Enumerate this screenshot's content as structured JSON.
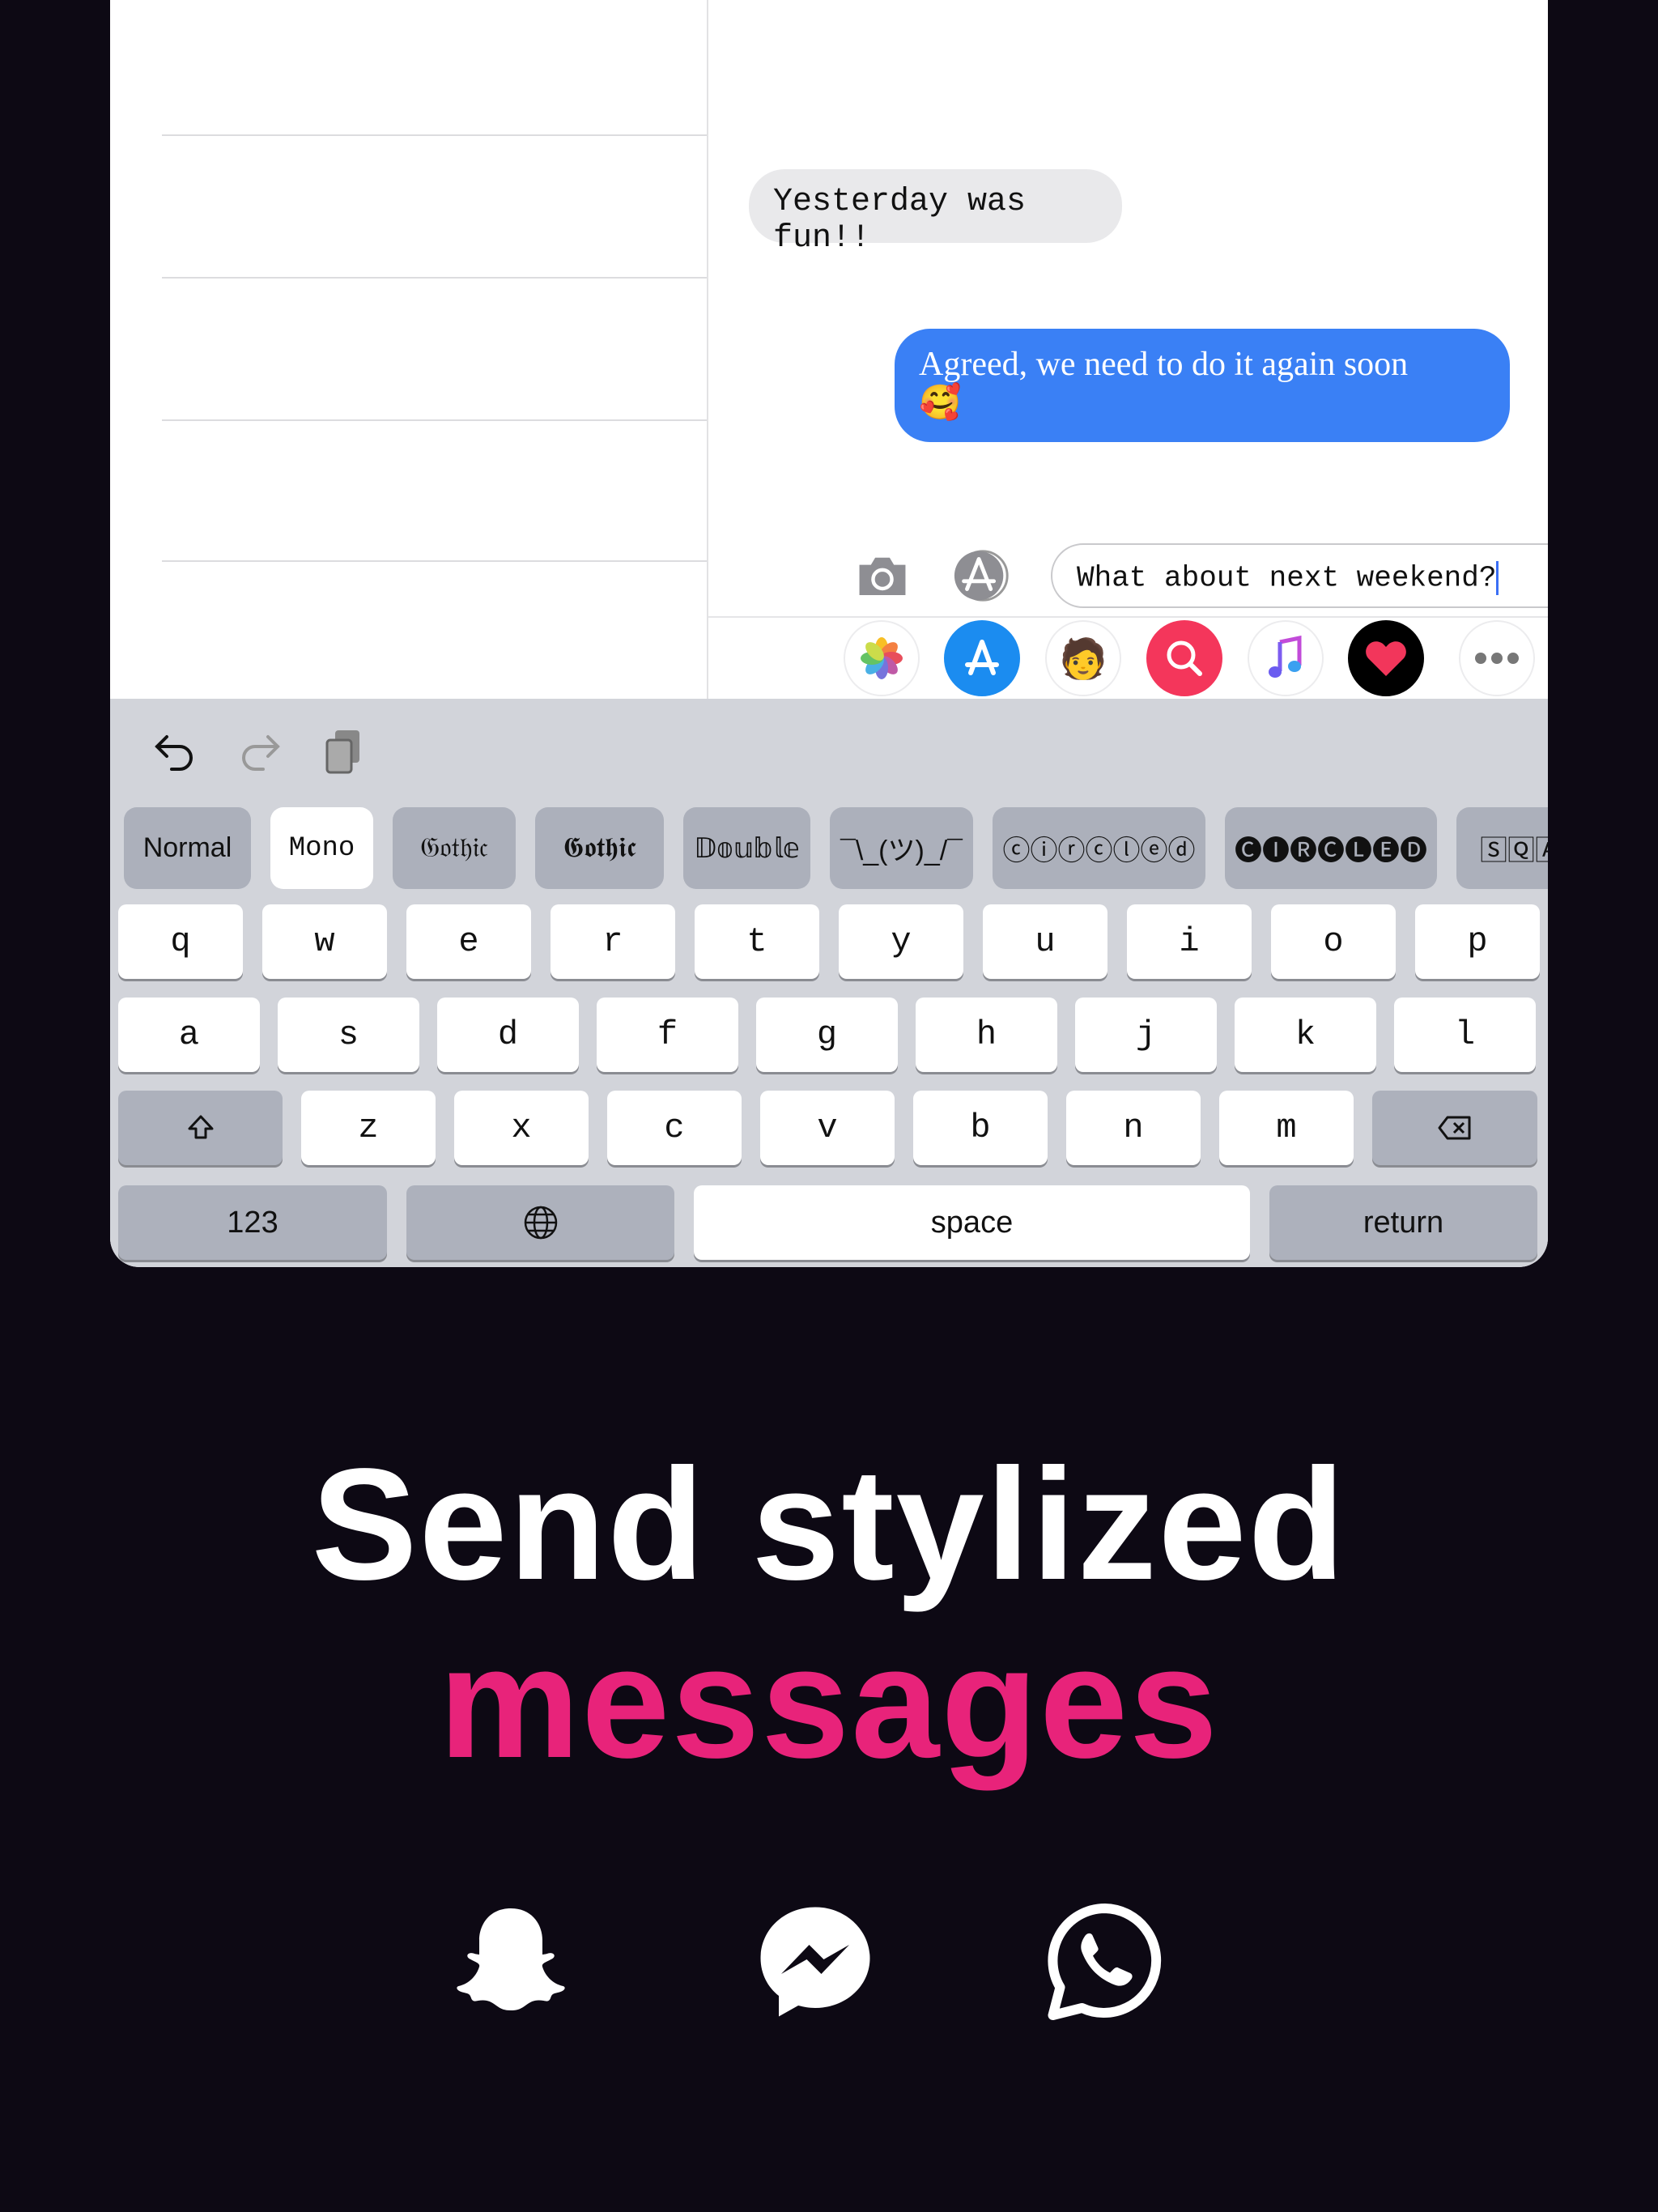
{
  "messages": [
    {
      "direction": "incoming",
      "text": "Yesterday was fun!!"
    },
    {
      "direction": "outgoing",
      "text": "Agreed, we need to do it again soon",
      "emoji": "🥰"
    }
  ],
  "composer": {
    "value": "What about next weekend?"
  },
  "app_drawer": [
    "photos-icon",
    "app-store-icon",
    "memoji-icon",
    "image-search-icon",
    "music-icon",
    "digital-touch-icon",
    "more-icon"
  ],
  "style_chips": [
    {
      "label": "Normal",
      "selected": false
    },
    {
      "label": "Mono",
      "selected": true
    },
    {
      "label": "𝔊𝔬𝔱𝔥𝔦𝔠",
      "selected": false
    },
    {
      "label": "𝕲𝖔𝖙𝖍𝖎𝖈",
      "selected": false
    },
    {
      "label": "𝔻𝕠𝕦𝕓𝕝𝕖",
      "selected": false
    },
    {
      "label": "¯\\_(ツ)_/¯",
      "selected": false
    },
    {
      "label": "ⓒⓘⓡⓒⓛⓔⓓ",
      "selected": false
    },
    {
      "label": "🅒🅘🅡🅒🅛🅔🅓",
      "selected": false
    },
    {
      "label": "🅂🅀🄰",
      "selected": false
    }
  ],
  "keyboard": {
    "row1": [
      "q",
      "w",
      "e",
      "r",
      "t",
      "y",
      "u",
      "i",
      "o",
      "p"
    ],
    "row2": [
      "a",
      "s",
      "d",
      "f",
      "g",
      "h",
      "j",
      "k",
      "l"
    ],
    "row3": [
      "z",
      "x",
      "c",
      "v",
      "b",
      "n",
      "m"
    ],
    "numbers": "123",
    "space": "space",
    "return": "return"
  },
  "headline": {
    "line1": "Send stylized",
    "line2": "messages"
  },
  "colors": {
    "accent": "#e8237a",
    "bubble_blue": "#3a80f5",
    "background": "#0d0914"
  },
  "platforms": [
    "snapchat-icon",
    "messenger-icon",
    "whatsapp-icon"
  ]
}
